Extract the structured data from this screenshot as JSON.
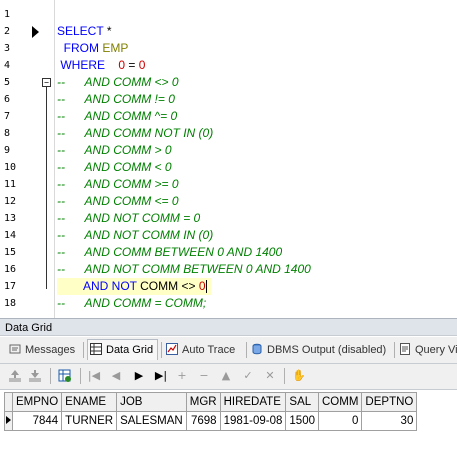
{
  "editor": {
    "lines": [
      {
        "n": "1",
        "tokens": []
      },
      {
        "n": "2",
        "tokens": [
          {
            "t": "SELECT ",
            "c": "kw"
          },
          {
            "t": "*",
            "c": "op"
          }
        ]
      },
      {
        "n": "3",
        "tokens": [
          {
            "t": "  FROM ",
            "c": "kw"
          },
          {
            "t": "EMP",
            "c": "tbl"
          }
        ]
      },
      {
        "n": "4",
        "tokens": [
          {
            "t": " WHERE    ",
            "c": "kw"
          },
          {
            "t": "0",
            "c": "num"
          },
          {
            "t": " = ",
            "c": "op"
          },
          {
            "t": "0",
            "c": "num"
          }
        ]
      },
      {
        "n": "5",
        "tokens": [
          {
            "t": "--      AND COMM <> 0",
            "c": "cm"
          }
        ]
      },
      {
        "n": "6",
        "tokens": [
          {
            "t": "--      AND COMM != 0",
            "c": "cm"
          }
        ]
      },
      {
        "n": "7",
        "tokens": [
          {
            "t": "--      AND COMM ^= 0",
            "c": "cm"
          }
        ]
      },
      {
        "n": "8",
        "tokens": [
          {
            "t": "--      AND COMM NOT IN (0)",
            "c": "cm"
          }
        ]
      },
      {
        "n": "9",
        "tokens": [
          {
            "t": "--      AND COMM > 0",
            "c": "cm"
          }
        ]
      },
      {
        "n": "10",
        "tokens": [
          {
            "t": "--      AND COMM < 0",
            "c": "cm"
          }
        ]
      },
      {
        "n": "11",
        "tokens": [
          {
            "t": "--      AND COMM >= 0",
            "c": "cm"
          }
        ]
      },
      {
        "n": "12",
        "tokens": [
          {
            "t": "--      AND COMM <= 0",
            "c": "cm"
          }
        ]
      },
      {
        "n": "13",
        "tokens": [
          {
            "t": "--      AND NOT COMM = 0",
            "c": "cm"
          }
        ]
      },
      {
        "n": "14",
        "tokens": [
          {
            "t": "--      AND NOT COMM IN (0)",
            "c": "cm"
          }
        ]
      },
      {
        "n": "15",
        "tokens": [
          {
            "t": "--      AND COMM BETWEEN 0 AND 1400",
            "c": "cm"
          }
        ]
      },
      {
        "n": "16",
        "tokens": [
          {
            "t": "--      AND NOT COMM BETWEEN 0 AND 1400",
            "c": "cm"
          }
        ]
      },
      {
        "n": "17",
        "tokens": [
          {
            "t": "        AND NOT ",
            "c": "kw"
          },
          {
            "t": "COMM",
            "c": "op"
          },
          {
            "t": " <> ",
            "c": "op"
          },
          {
            "t": "0",
            "c": "num"
          }
        ],
        "current": true
      },
      {
        "n": "18",
        "tokens": [
          {
            "t": "--      AND COMM = COMM;",
            "c": "cm"
          }
        ]
      }
    ]
  },
  "panel": {
    "title": "Data Grid",
    "tabs": [
      {
        "label": "Messages",
        "icon": "messages-icon"
      },
      {
        "label": "Data Grid",
        "icon": "data-grid-icon",
        "active": true
      },
      {
        "label": "Auto Trace",
        "icon": "auto-trace-icon"
      },
      {
        "label": "DBMS Output (disabled)",
        "icon": "dbms-output-icon"
      },
      {
        "label": "Query Vi",
        "icon": "query-viewer-icon"
      }
    ]
  },
  "grid": {
    "columns": [
      "EMPNO",
      "ENAME",
      "JOB",
      "MGR",
      "HIREDATE",
      "SAL",
      "COMM",
      "DEPTNO"
    ],
    "rows": [
      [
        "7844",
        "TURNER",
        "SALESMAN",
        "7698",
        "1981-09-08",
        "1500",
        "0",
        "30"
      ]
    ]
  }
}
